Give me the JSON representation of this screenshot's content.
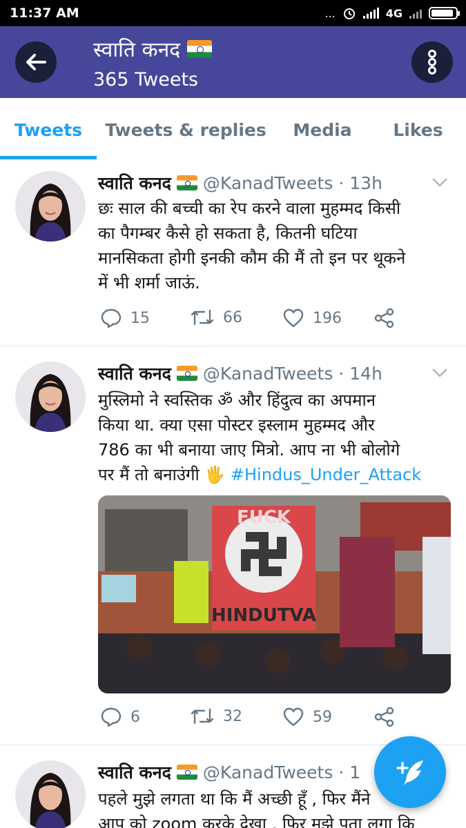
{
  "status_bar": {
    "time": "11:37 AM",
    "dots": "...",
    "network": "4G"
  },
  "profile": {
    "name": "स्वाति कनद",
    "tweet_count": "365 Tweets"
  },
  "tabs": [
    {
      "label": "Tweets",
      "active": true
    },
    {
      "label": "Tweets & replies",
      "active": false
    },
    {
      "label": "Media",
      "active": false
    },
    {
      "label": "Likes",
      "active": false
    }
  ],
  "tweets": [
    {
      "name": "स्वाति कनद",
      "handle": "@KanadTweets",
      "time": "· 13h",
      "lines": [
        "छः साल की बच्ची का रेप करने वाला मुहम्मद किसी",
        "का पैगम्बर कैसे हो सकता है, कितनी घटिया",
        "मानसिकता होगी इनकी कौम की मैं तो इन पर थूकने",
        "में भी शर्मा जाऊं."
      ],
      "replies": "15",
      "retweets": "66",
      "likes": "196"
    },
    {
      "name": "स्वाति कनद",
      "handle": "@KanadTweets",
      "time": "· 14h",
      "lines": [
        "मुस्लिमो ने स्वस्तिक ॐ  और हिंदुत्व का अपमान",
        "किया था. क्या  एसा पोस्टर इस्लाम मुहम्मद और",
        "786 का भी बनाया जाए मित्रो.  आप ना भी बोलोगे",
        "पर मैं तो बनाउंगी"
      ],
      "emoji": "🖐",
      "hashtag": "#Hindus_Under_Attack",
      "image_text": {
        "top": "FUCK",
        "bottom": "HINDUTVA"
      },
      "replies": "6",
      "retweets": "32",
      "likes": "59"
    },
    {
      "name": "स्वाति कनद",
      "handle": "@KanadTweets",
      "time": "· 1",
      "lines": [
        "पहले मुझे लगता था कि मैं अच्छी हूँ , फिर मैंने",
        "आप को zoom करके देखा , फिर मुझे पता लगा कि"
      ]
    }
  ],
  "colors": {
    "header_bg": "#46479a",
    "accent": "#1da1f2",
    "muted": "#657786"
  },
  "icons": [
    "back-arrow-icon",
    "overflow-menu-icon",
    "reply-icon",
    "retweet-icon",
    "like-icon",
    "share-icon",
    "compose-tweet-icon",
    "caret-down-icon",
    "india-flag-icon"
  ]
}
